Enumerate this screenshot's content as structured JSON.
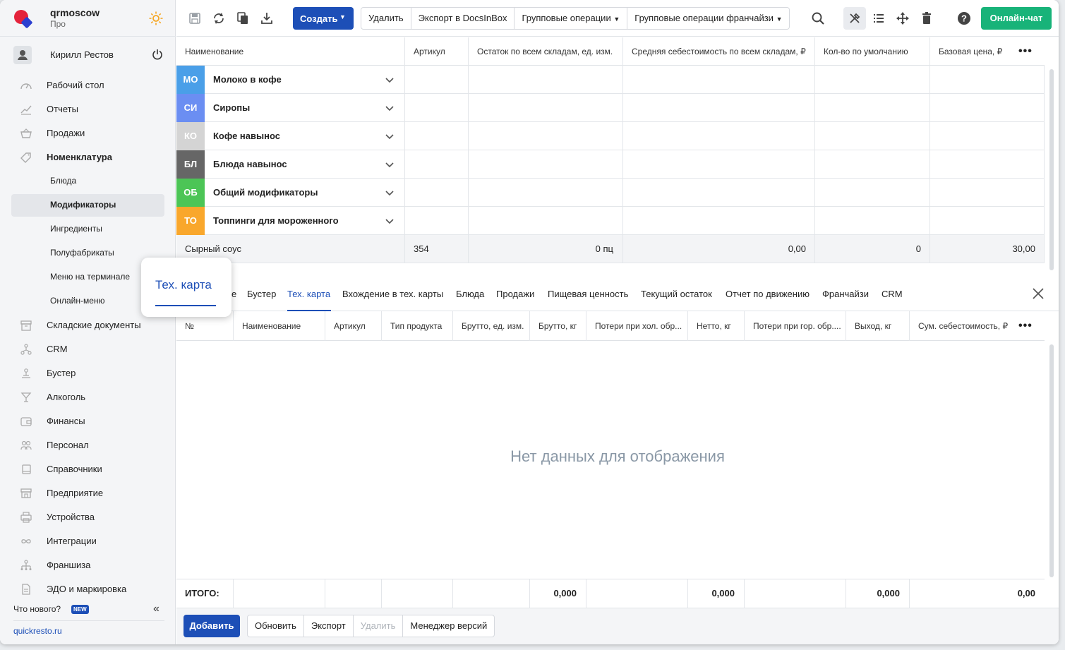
{
  "brand": {
    "name": "qrmoscow",
    "plan": "Про"
  },
  "user": {
    "name": "Кирилл Рестов"
  },
  "sidebar": {
    "items": [
      {
        "label": "Рабочий стол",
        "icon": "dashboard-icon"
      },
      {
        "label": "Отчеты",
        "icon": "chart-icon"
      },
      {
        "label": "Продажи",
        "icon": "basket-icon"
      },
      {
        "label": "Номенклатура",
        "icon": "tag-icon"
      },
      {
        "label": "Блюда"
      },
      {
        "label": "Модификаторы"
      },
      {
        "label": "Ингредиенты"
      },
      {
        "label": "Полуфабрикаты"
      },
      {
        "label": "Меню на терминале"
      },
      {
        "label": "Онлайн-меню"
      },
      {
        "label": "Складские документы",
        "icon": "warehouse-icon"
      },
      {
        "label": "CRM",
        "icon": "crm-icon"
      },
      {
        "label": "Бустер",
        "icon": "booster-icon"
      },
      {
        "label": "Алкоголь",
        "icon": "glass-icon"
      },
      {
        "label": "Финансы",
        "icon": "wallet-icon"
      },
      {
        "label": "Персонал",
        "icon": "people-icon"
      },
      {
        "label": "Справочники",
        "icon": "book-icon"
      },
      {
        "label": "Предприятие",
        "icon": "store-icon"
      },
      {
        "label": "Устройства",
        "icon": "printer-icon"
      },
      {
        "label": "Интеграции",
        "icon": "infinity-icon"
      },
      {
        "label": "Франшиза",
        "icon": "franchise-icon"
      },
      {
        "label": "ЭДО и маркировка",
        "icon": "document-icon"
      }
    ],
    "whats_new": "Что нового?",
    "new_badge": "NEW",
    "site": "quickresto.ru"
  },
  "toolbar": {
    "create": "Создать",
    "group": [
      "Удалить",
      "Экспорт в DocsInBox",
      "Групповые операции",
      "Групповые операции франчайзи"
    ],
    "chat": "Онлайн-чат"
  },
  "top_table": {
    "headers": [
      "Наименование",
      "Артикул",
      "Остаток по всем складам, ед. изм.",
      "Средняя себестоимость по всем складам, ₽",
      "Кол-во по умолчанию",
      "Базовая цена, ₽"
    ],
    "groups": [
      {
        "abbr": "МО",
        "name": "Молоко в кофе",
        "color": "#4a9fe8"
      },
      {
        "abbr": "СИ",
        "name": "Сиропы",
        "color": "#6b8ef2"
      },
      {
        "abbr": "КО",
        "name": "Кофе навынос",
        "color": "#d4d4d4"
      },
      {
        "abbr": "БЛ",
        "name": "Блюда навынос",
        "color": "#666666"
      },
      {
        "abbr": "ОБ",
        "name": "Общий модификаторы",
        "color": "#4cc556"
      },
      {
        "abbr": "ТО",
        "name": "Топпинги для мороженного",
        "color": "#f9a72c"
      }
    ],
    "selected_row": {
      "name": "Сырный соус",
      "article": "354",
      "stock": "0 пц",
      "avg_cost": "0,00",
      "default_qty": "0",
      "base_price": "30,00"
    }
  },
  "tabs": {
    "items": [
      "Бустер",
      "Тех. карта",
      "Вхождение в тех. карты",
      "Блюда",
      "Продажи",
      "Пищевая ценность",
      "Текущий остаток",
      "Отчет по движению",
      "Франчайзи",
      "CRM"
    ],
    "partial": "е",
    "active": "Тех. карта"
  },
  "bottom_table": {
    "headers": [
      "№",
      "Наименование",
      "Артикул",
      "Тип продукта",
      "Брутто, ед. изм.",
      "Брутто, кг",
      "Потери при хол. обр...",
      "Нетто, кг",
      "Потери при гор. обр....",
      "Выход, кг",
      "Сум. себестоимость, ₽"
    ],
    "empty": "Нет данных для отображения",
    "total_label": "ИТОГО:",
    "totals": {
      "brutto_kg": "0,000",
      "netto_kg": "0,000",
      "output_kg": "0,000",
      "cost": "0,00"
    }
  },
  "footer": {
    "add": "Добавить",
    "buttons": [
      "Обновить",
      "Экспорт",
      "Удалить",
      "Менеджер версий"
    ]
  },
  "callout": {
    "label": "Тех. карта"
  },
  "colors": {
    "accent": "#1d4fb7",
    "chat": "#18b379"
  }
}
